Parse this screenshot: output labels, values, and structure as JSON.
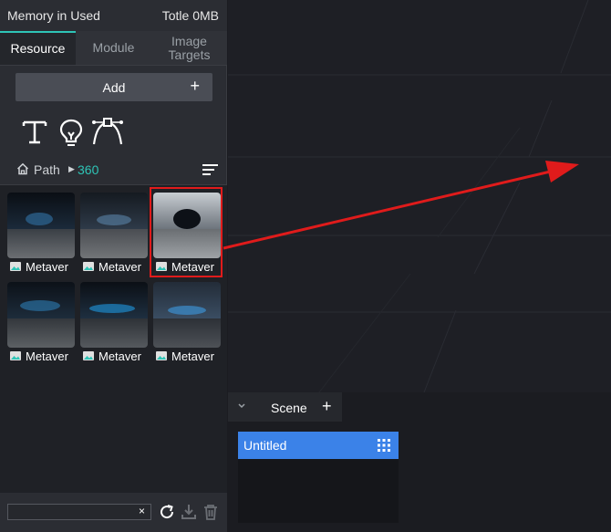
{
  "header": {
    "memory_label": "Memory in Used",
    "total_label": "Totle 0MB"
  },
  "tabs": [
    {
      "label": "Resource",
      "active": true
    },
    {
      "label": "Module",
      "active": false
    },
    {
      "label": "Image Targets",
      "active": false
    }
  ],
  "add_button": {
    "label": "Add",
    "icon": "plus"
  },
  "tools": [
    "text-tool-icon",
    "light-bulb-icon",
    "bezier-pen-icon"
  ],
  "path": {
    "label": "Path",
    "current_folder": "360"
  },
  "resources": [
    {
      "label": "Metaver",
      "selected": false
    },
    {
      "label": "Metaver",
      "selected": false
    },
    {
      "label": "Metaver",
      "selected": true
    },
    {
      "label": "Metaver",
      "selected": false
    },
    {
      "label": "Metaver",
      "selected": false
    },
    {
      "label": "Metaver",
      "selected": false
    }
  ],
  "bottom_bar": {
    "search_value": "",
    "clear_symbol": "×"
  },
  "scene_panel": {
    "tab_label": "Scene",
    "add_symbol": "+",
    "items": [
      {
        "label": "Untitled",
        "selected": true
      }
    ]
  },
  "colors": {
    "accent": "#2ec4b6",
    "selection_blue": "#3b82e8",
    "annotation_red": "#e01b1b"
  }
}
